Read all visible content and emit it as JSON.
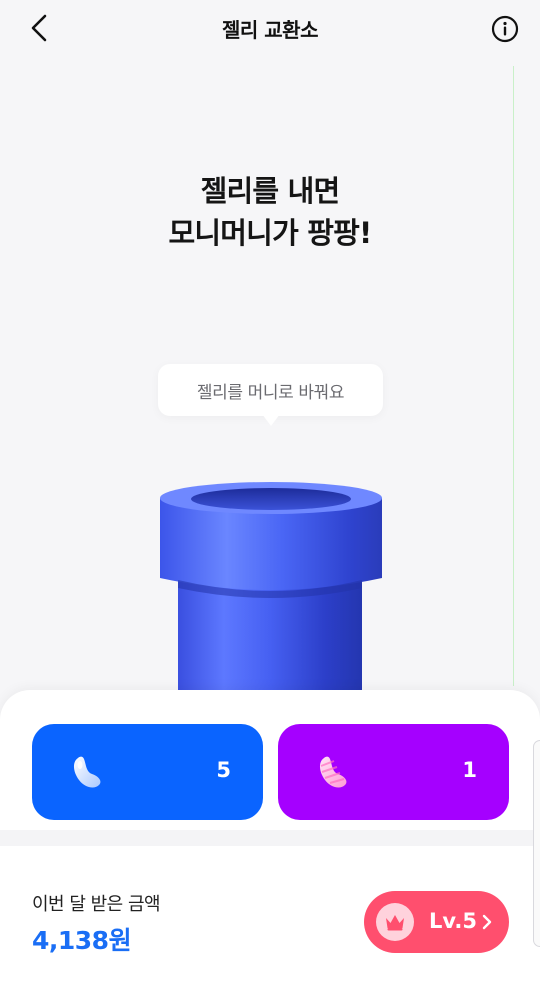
{
  "header": {
    "title": "젤리 교환소",
    "back_icon": "chevron-left-icon",
    "info_icon": "info-circle-icon"
  },
  "hero": {
    "title_line1": "젤리를 내면",
    "title_line2": "모니머니가 팡팡!",
    "tooltip": "젤리를 머니로 바꿔요",
    "image": "blue-pipe-illustration"
  },
  "jellies": [
    {
      "color": "#0a64ff",
      "icon": "blue-jelly-bean-icon",
      "count": "5"
    },
    {
      "color": "#a500ff",
      "icon": "pink-striped-jelly-bean-icon",
      "count": "1"
    }
  ],
  "earnings": {
    "label": "이번 달 받은 금액",
    "amount": "4,138원"
  },
  "level": {
    "label": "Lv.5",
    "icon": "crown-icon",
    "chevron": "chevron-right-icon",
    "color": "#ff4f6e"
  },
  "colors": {
    "accent_blue": "#1a6ef5",
    "background": "#f6f6f8"
  }
}
